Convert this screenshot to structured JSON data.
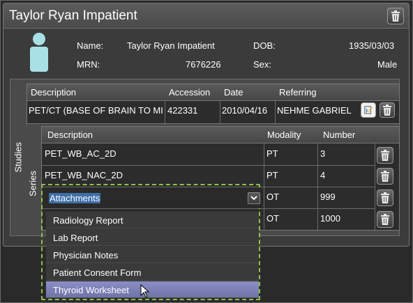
{
  "window": {
    "title": "Taylor Ryan Impatient"
  },
  "patient": {
    "name_label": "Name:",
    "name_value": "Taylor Ryan Impatient",
    "dob_label": "DOB:",
    "dob_value": "1935/03/03",
    "mrn_label": "MRN:",
    "mrn_value": "7676226",
    "sex_label": "Sex:",
    "sex_value": "Male"
  },
  "studies": {
    "section_label": "Studies",
    "columns": [
      "Description",
      "Accession",
      "Date",
      "Referring"
    ],
    "rows": [
      {
        "description": "PET/CT (BASE OF BRAIN TO MID",
        "accession": "422331",
        "date": "2010/04/16",
        "referring": "NEHME GABRIEL"
      }
    ]
  },
  "series": {
    "section_label": "Series",
    "columns": [
      "Description",
      "Modality",
      "Number"
    ],
    "rows": [
      {
        "description": "PET_WB_AC_2D",
        "modality": "PT",
        "number": "3"
      },
      {
        "description": "PET_WB_NAC_2D",
        "modality": "PT",
        "number": "4"
      },
      {
        "description": "",
        "modality": "OT",
        "number": "999"
      },
      {
        "description": "",
        "modality": "OT",
        "number": "1000"
      }
    ]
  },
  "dropdown": {
    "selected_value": "Attachments",
    "options": [
      "Radiology Report",
      "Lab Report",
      "Physician Notes",
      "Patient Consent Form",
      "Thyroid Worksheet"
    ],
    "highlighted_index": 4
  },
  "colors": {
    "patient_icon": "#a8e0e6",
    "selection_blue": "#3d6fa8",
    "dashed_focus": "#8bc34a",
    "highlight_item": "#7c80b8"
  },
  "icons": [
    "trash-icon",
    "person-icon",
    "edit-report-icon",
    "chevron-down-icon",
    "mouse-cursor-icon"
  ]
}
